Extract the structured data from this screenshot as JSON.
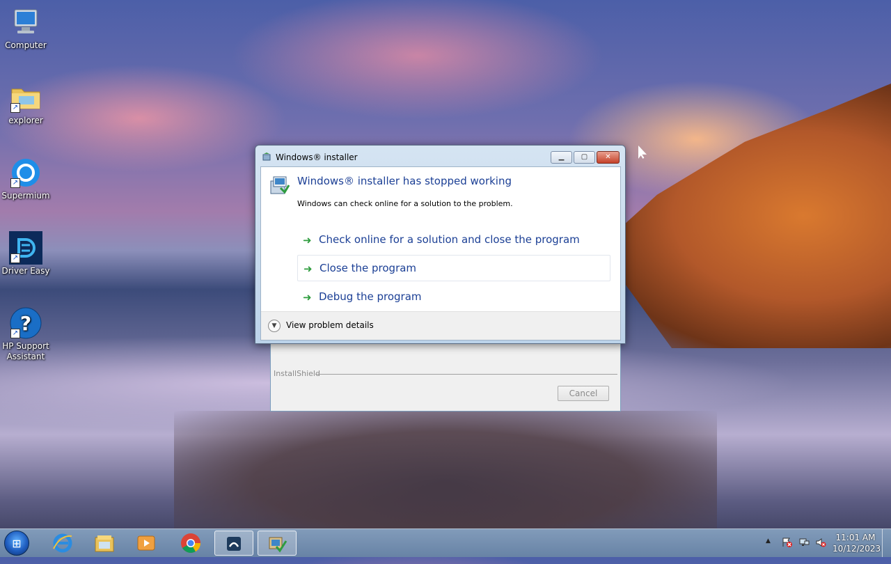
{
  "desktop": {
    "icons": [
      {
        "label": "Computer",
        "icon": "computer-icon"
      },
      {
        "label": "explorer",
        "icon": "folder-icon"
      },
      {
        "label": "Supermium",
        "icon": "browser-icon"
      },
      {
        "label": "Driver Easy",
        "icon": "driver-easy-icon"
      },
      {
        "label": "HP Support Assistant",
        "icon": "help-icon"
      }
    ]
  },
  "installer_window": {
    "label": "InstallShield",
    "cancel_label": "Cancel"
  },
  "dialog": {
    "title": "Windows® installer",
    "heading": "Windows® installer has stopped working",
    "subtext": "Windows can check online for a solution to the problem.",
    "options": [
      "Check online for a solution and close the program",
      "Close the program",
      "Debug the program"
    ],
    "details_label": "View problem details",
    "controls": {
      "minimize": "▁",
      "maximize": "▢",
      "close": "✕"
    }
  },
  "taskbar": {
    "apps": [
      "internet-explorer-icon",
      "file-explorer-icon",
      "media-player-icon",
      "chrome-icon",
      "installer-app-icon",
      "windows-installer-icon"
    ],
    "clock": {
      "time": "11:01 AM",
      "date": "10/12/2023"
    }
  },
  "colors": {
    "link_blue": "#1b3f95",
    "arrow_green": "#2e9c3e"
  }
}
